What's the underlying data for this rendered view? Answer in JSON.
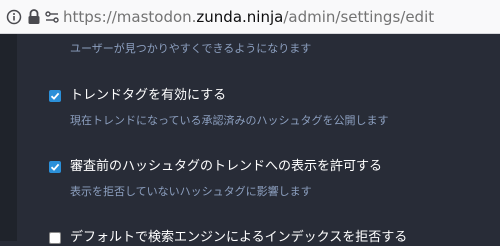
{
  "address_bar": {
    "url_prefix": "https://mastodon.",
    "url_host": "zunda.ninja",
    "url_path": "/admin/settings/edit"
  },
  "settings": {
    "prev_hint": "ユーザーが見つかりやすくできるようになります",
    "trends": {
      "label": "トレンドタグを有効にする",
      "hint": "現在トレンドになっている承認済みのハッシュタグを公開します",
      "checked": true
    },
    "trendable_by_default": {
      "label": "審査前のハッシュタグのトレンドへの表示を許可する",
      "hint": "表示を拒否していないハッシュタグに影響します",
      "checked": true
    },
    "noindex": {
      "label": "デフォルトで検索エンジンによるインデックスを拒否する",
      "checked": false
    }
  },
  "colors": {
    "page_background": "#282c37",
    "checkbox_accent": "#2b90d9",
    "hint_text": "#8c9fbf",
    "label_text": "#ffffff"
  }
}
